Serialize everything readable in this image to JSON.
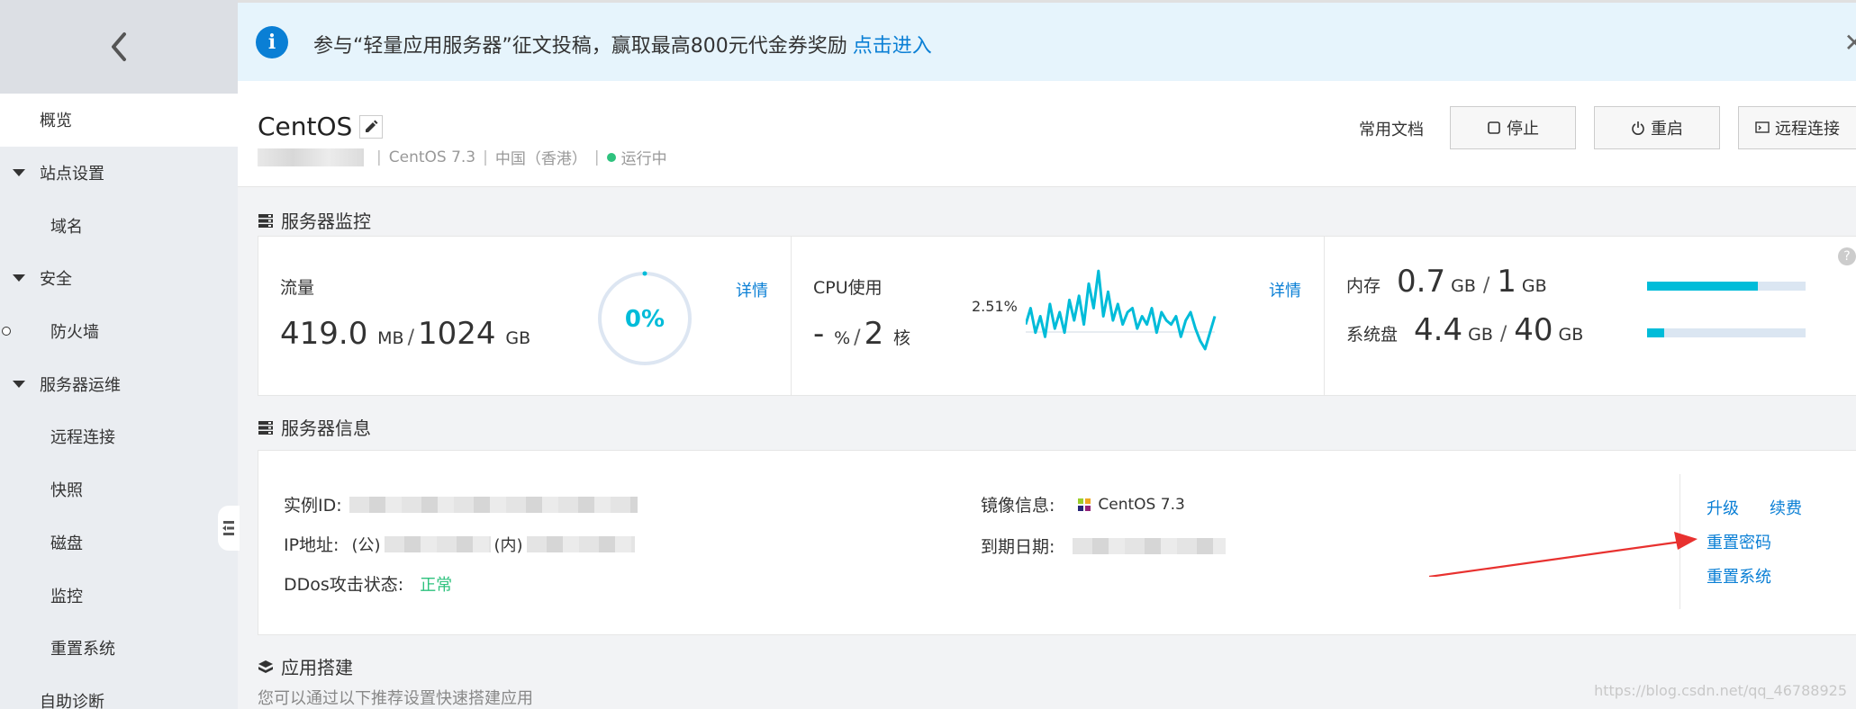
{
  "sidebar": {
    "items": [
      {
        "label": "概览"
      },
      {
        "label": "站点设置"
      },
      {
        "label": "域名"
      },
      {
        "label": "安全"
      },
      {
        "label": "防火墙"
      },
      {
        "label": "服务器运维"
      },
      {
        "label": "远程连接"
      },
      {
        "label": "快照"
      },
      {
        "label": "磁盘"
      },
      {
        "label": "监控"
      },
      {
        "label": "重置系统"
      },
      {
        "label": "自助诊断"
      }
    ]
  },
  "banner": {
    "text": "参与“轻量应用服务器”征文投稿，赢取最高800元代金券奖励",
    "link": "点击进入",
    "close": "✕"
  },
  "header": {
    "title": "CentOS",
    "os": "CentOS 7.3",
    "region": "中国（香港）",
    "sep": "|",
    "status": "运行中",
    "docs": "常用文档",
    "stop": "停止",
    "restart": "重启",
    "remote": "远程连接"
  },
  "monitor": {
    "section_title": "服务器监控",
    "traffic": {
      "label": "流量",
      "used": "419.0",
      "used_unit": "MB",
      "total": "1024",
      "total_unit": "GB",
      "percent": "0%",
      "detail": "详情"
    },
    "cpu": {
      "label": "CPU使用",
      "value": "-",
      "value_unit": "%",
      "cores": "2",
      "cores_unit": "核",
      "peak": "2.51%",
      "detail": "详情"
    },
    "memory": {
      "label": "内存",
      "used": "0.7",
      "used_unit": "GB",
      "total": "1",
      "total_unit": "GB",
      "fraction": 0.7
    },
    "disk": {
      "label": "系统盘",
      "used": "4.4",
      "used_unit": "GB",
      "total": "40",
      "total_unit": "GB",
      "fraction": 0.11
    },
    "help": "?"
  },
  "info": {
    "section_title": "服务器信息",
    "instance_id_label": "实例ID:",
    "ip_label": "IP地址:",
    "ip_public": "(公)",
    "ip_private": "(内)",
    "ddos_label": "DDos攻击状态:",
    "ddos_value": "正常",
    "image_label": "镜像信息:",
    "image_value": "CentOS 7.3",
    "expire_label": "到期日期:",
    "upgrade": "升级",
    "renew": "续费",
    "reset_password": "重置密码",
    "reset_system": "重置系统"
  },
  "deploy": {
    "section_title": "应用搭建",
    "subtitle": "您可以通过以下推荐设置快速搭建应用"
  },
  "watermark": "https://blog.csdn.net/qq_46788925",
  "colors": {
    "accent": "#0a7fd5",
    "chart_line": "#00bcd9",
    "ok": "#2ec27e"
  },
  "chart_data": {
    "type": "line",
    "values": [
      1.2,
      1.6,
      1.0,
      1.4,
      0.9,
      1.7,
      1.1,
      1.5,
      1.0,
      1.8,
      1.3,
      1.9,
      1.2,
      2.2,
      1.6,
      2.51,
      1.4,
      2.0,
      1.3,
      1.7,
      1.2,
      1.5,
      1.6,
      1.1,
      1.4,
      1.2,
      1.6,
      1.0,
      1.5,
      1.3,
      1.2,
      1.4,
      0.9,
      1.3,
      1.5,
      1.1,
      0.8,
      0.6,
      1.0,
      1.4
    ],
    "ylabel": "2.51%"
  }
}
